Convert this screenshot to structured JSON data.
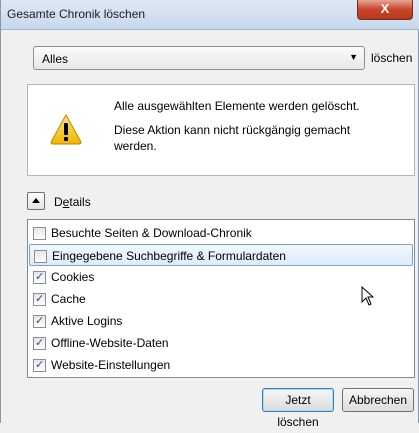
{
  "window": {
    "title": "Gesamte Chronik löschen",
    "close_label": "X"
  },
  "range": {
    "selected": "Alles",
    "suffix_label": "löschen"
  },
  "warning": {
    "line1": "Alle ausgewählten Elemente werden gelöscht.",
    "line2": "Diese Aktion kann nicht rückgängig gemacht werden."
  },
  "details": {
    "label_prefix": "D",
    "label_underlined": "e",
    "label_rest": "tails"
  },
  "items": [
    {
      "label": "Besuchte Seiten & Download-Chronik",
      "checked": false,
      "selected": false
    },
    {
      "label": "Eingegebene Suchbegriffe & Formulardaten",
      "checked": false,
      "selected": true
    },
    {
      "label": "Cookies",
      "checked": true,
      "selected": false
    },
    {
      "label": "Cache",
      "checked": true,
      "selected": false
    },
    {
      "label": "Aktive Logins",
      "checked": true,
      "selected": false
    },
    {
      "label": "Offline-Website-Daten",
      "checked": true,
      "selected": false
    },
    {
      "label": "Website-Einstellungen",
      "checked": true,
      "selected": false
    }
  ],
  "buttons": {
    "clear_now": "Jetzt löschen",
    "cancel": "Abbrechen"
  }
}
